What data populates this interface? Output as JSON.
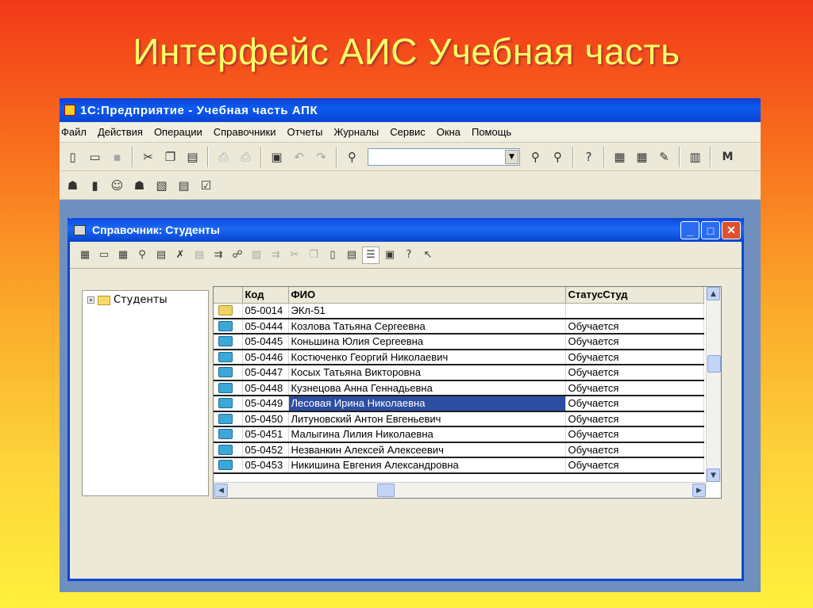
{
  "slide": {
    "title": "Интерфейс АИС Учебная часть"
  },
  "app": {
    "title": "1С:Предприятие - Учебная часть АПК"
  },
  "menu": [
    "Файл",
    "Действия",
    "Операции",
    "Справочники",
    "Отчеты",
    "Журналы",
    "Сервис",
    "Окна",
    "Помощь"
  ],
  "toolbar": {
    "search_value": "",
    "overflow_label": "М"
  },
  "window": {
    "title": "Справочник: Студенты"
  },
  "tree": {
    "root_label": "Студенты"
  },
  "table": {
    "columns": [
      "Код",
      "ФИО",
      "СтатусСтуд"
    ],
    "rows": [
      {
        "code": "05-0014",
        "fio": "ЭКл-51",
        "status": "",
        "group": true
      },
      {
        "code": "05-0444",
        "fio": "Козлова Татьяна Сергеевна",
        "status": "Обучается"
      },
      {
        "code": "05-0445",
        "fio": "Коньшина Юлия Сергеевна",
        "status": "Обучается"
      },
      {
        "code": "05-0446",
        "fio": "Костюченко Георгий Николаевич",
        "status": "Обучается"
      },
      {
        "code": "05-0447",
        "fio": "Косых Татьяна Викторовна",
        "status": "Обучается"
      },
      {
        "code": "05-0448",
        "fio": "Кузнецова Анна Геннадьевна",
        "status": "Обучается"
      },
      {
        "code": "05-0449",
        "fio": "Лесовая Ирина Николаевна",
        "status": "Обучается",
        "selected": true
      },
      {
        "code": "05-0450",
        "fio": "Литуновский Антон Евгеньевич",
        "status": "Обучается"
      },
      {
        "code": "05-0451",
        "fio": "Малыгина Лилия Николаевна",
        "status": "Обучается"
      },
      {
        "code": "05-0452",
        "fio": "Незванкин Алексей Алексеевич",
        "status": "Обучается"
      },
      {
        "code": "05-0453",
        "fio": "Никишина Евгения Александровна",
        "status": "Обучается"
      }
    ]
  }
}
